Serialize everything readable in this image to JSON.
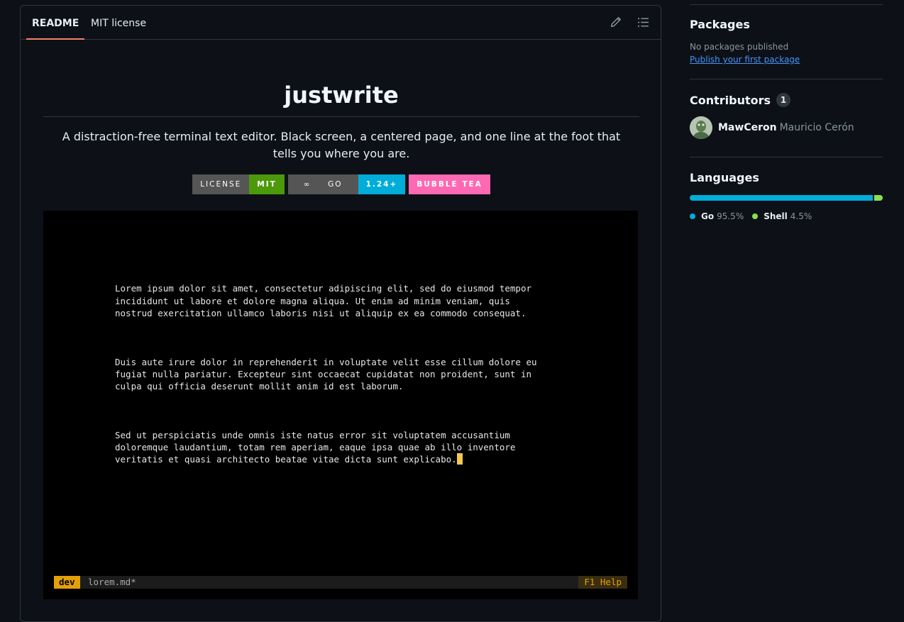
{
  "readme": {
    "tabs": [
      {
        "label": "README",
        "active": true
      },
      {
        "label": "MIT license",
        "active": false
      }
    ],
    "tool_icons": [
      "pencil-icon",
      "list-unordered-icon"
    ],
    "title": "justwrite",
    "description": "A distraction-free terminal text editor. Black screen, a centered page, and one line at the foot that tells you where you are.",
    "badges": [
      {
        "label": "LICENSE",
        "value": "MIT",
        "color": "#4c9a0b"
      },
      {
        "label": "GO",
        "value": "1.24+",
        "color": "#00add8",
        "icon": "go-link-icon"
      },
      {
        "label": "",
        "value": "BUBBLE TEA",
        "color": "#ff69b4"
      }
    ],
    "terminal": {
      "paragraphs": [
        "Lorem ipsum dolor sit amet, consectetur adipiscing elit, sed do eiusmod tempor\nincididunt ut labore et dolore magna aliqua. Ut enim ad minim veniam, quis\nnostrud exercitation ullamco laboris nisi ut aliquip ex ea commodo consequat.",
        "Duis aute irure dolor in reprehenderit in voluptate velit esse cillum dolore eu\nfugiat nulla pariatur. Excepteur sint occaecat cupidatat non proident, sunt in\nculpa qui officia deserunt mollit anim id est laborum.",
        "Sed ut perspiciatis unde omnis iste natus error sit voluptatem accusantium\ndoloremque laudantium, totam rem aperiam, eaque ipsa quae ab illo inventore\nveritatis et quasi architecto beatae vitae dicta sunt explicabo."
      ],
      "status": {
        "mode": "dev",
        "file": "lorem.md*",
        "help": "F1 Help"
      },
      "colors": {
        "mode_bg": "#e3a008",
        "cursor": "#f2c94c"
      }
    }
  },
  "sidebar": {
    "packages": {
      "heading": "Packages",
      "none_text": "No packages published",
      "link": "Publish your first package"
    },
    "contributors": {
      "heading": "Contributors",
      "count": "1",
      "items": [
        {
          "login": "MawCeron",
          "name": "Mauricio Cerón"
        }
      ]
    },
    "languages": {
      "heading": "Languages",
      "items": [
        {
          "name": "Go",
          "percent": "95.5%",
          "value": 95.5,
          "color": "#00add8"
        },
        {
          "name": "Shell",
          "percent": "4.5%",
          "value": 4.5,
          "color": "#89e051"
        }
      ]
    }
  }
}
